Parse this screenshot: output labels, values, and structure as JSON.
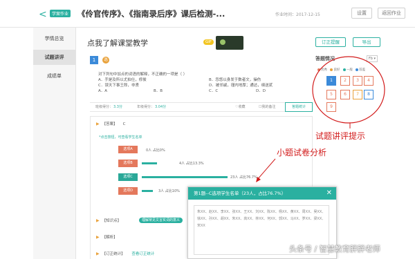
{
  "topbar": {
    "back_glyph": "<",
    "tag": "学案作业",
    "title": "《伶官传序》、《指南录后序》课后检测-...",
    "time_label": "作业时间：2017-12-15",
    "btn1": "设置",
    "btn2": "返回作业"
  },
  "sidebar": {
    "items": [
      {
        "label": "学情总览"
      },
      {
        "label": "试题讲评"
      },
      {
        "label": "成绩单"
      }
    ]
  },
  "main": {
    "title": "点我了解课堂教学",
    "gif_badge": "GIF",
    "btn_mark": "订正提醒",
    "btn_export": "导出",
    "question_number": "1",
    "question_type": "选",
    "stem": "对下列句中加点的词语的解释，不正确的一项是（    ）",
    "options_left": [
      "A．手是及所以尤拍仕，修俊",
      "C．误天下事王郎，非贤",
      "A．A"
    ],
    "options_left2": [
      "B．B"
    ],
    "options_right": [
      "B．忽悠以身发于数者文，操伤",
      "D．被邻戚，瑾内地厚；通达，纲送贰"
    ],
    "options_right2": [
      "C．C",
      "D．D"
    ],
    "stats": {
      "class_score_label": "班级得分：",
      "class_score": "3.3分",
      "grade_score_label": "年级得分：",
      "grade_score": "3.04分",
      "collect": "收藏",
      "note": "我的备注",
      "answer_stats": "答题统计"
    },
    "detail": {
      "answer_label": "【答案】",
      "answer_value": "C",
      "student_link": "*点击按钮，可查看学生名单",
      "options": [
        {
          "label": "选项A",
          "text": "0人  占比0%",
          "percent": 0
        },
        {
          "label": "选项B",
          "text": "4人  占比13.3%",
          "percent": 13.3
        },
        {
          "label": "选项C",
          "text": "23人  占比76.7%",
          "percent": 76.7
        },
        {
          "label": "选项D",
          "text": "3人  占比10%",
          "percent": 10
        }
      ],
      "knowledge_label": "【知识点】",
      "knowledge_pill": "理解常见文言实词的意义",
      "analysis_label": "【解析】",
      "error_label": "【订正统计】",
      "error_link": "查看订正统计"
    }
  },
  "right": {
    "title": "答题情况",
    "select": "Fb ▾",
    "legend": [
      {
        "label": "优秀",
        "color": "#e4785c"
      },
      {
        "label": "良好",
        "color": "#e9a23c"
      },
      {
        "label": "一般",
        "color": "#2ab0a0"
      },
      {
        "label": "较差",
        "color": "#3b8ad9"
      }
    ],
    "questions": [
      "1",
      "2",
      "3",
      "4",
      "5",
      "6",
      "7",
      "8",
      "9"
    ]
  },
  "annotations": {
    "hint1": "试题讲评提示",
    "hint2": "小题试卷分析"
  },
  "popup": {
    "title": "第1题--C选项学生名单（23人，占比76.7%）",
    "close": "✕",
    "names": "朱XX、赵XX、李XX、张XX、王XX、刘XX、陈XX、杨XX、黄XX、周XX、吴XX、徐XX、孙XX、胡XX、朱XX、高XX、林XX、何XX、郭XX、马XX、罗XX、梁XX、宋XX"
  },
  "watermark": "头条号 / 智慧教育胖胖老师"
}
